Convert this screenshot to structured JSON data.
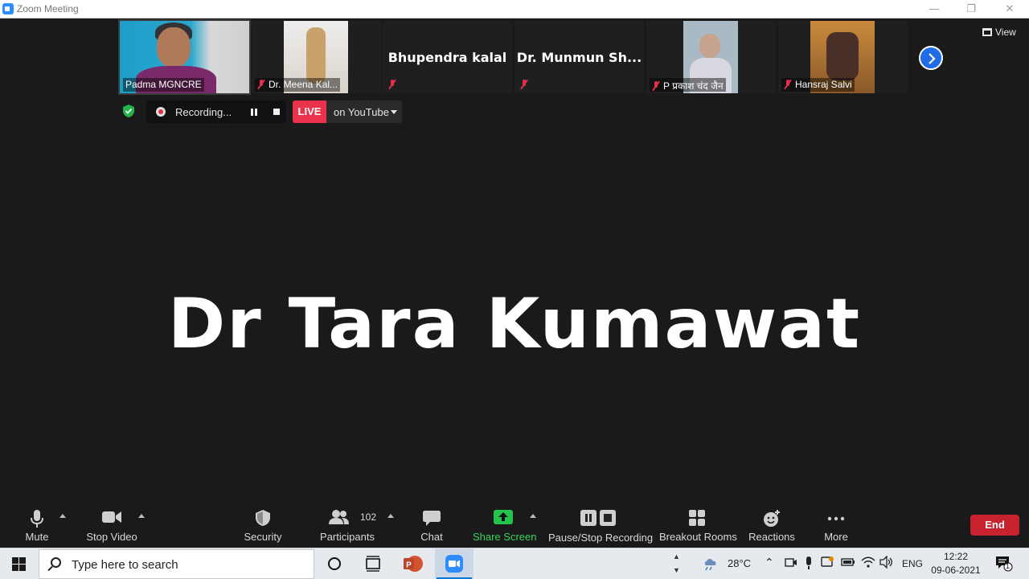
{
  "window": {
    "title": "Zoom Meeting"
  },
  "participants": [
    {
      "name": "Padma MGNCRE",
      "muted": false
    },
    {
      "name": "Dr. Meena Kal...",
      "muted": true
    },
    {
      "name": "Bhupendra kalal",
      "muted": true
    },
    {
      "name": "Dr. Munmun Sh...",
      "muted": true
    },
    {
      "name": "P प्रकाश चंद जैन",
      "muted": true
    },
    {
      "name": "Hansraj Salvi",
      "muted": true
    }
  ],
  "view_label": "View",
  "recording": {
    "status": "Recording..."
  },
  "live": {
    "badge": "LIVE",
    "platform": "on YouTube"
  },
  "active_speaker": "Dr Tara Kumawat",
  "toolbar": {
    "mute": "Mute",
    "stop_video": "Stop Video",
    "security": "Security",
    "participants": "Participants",
    "participants_count": "102",
    "chat": "Chat",
    "share_screen": "Share Screen",
    "pause_stop_recording": "Pause/Stop Recording",
    "breakout_rooms": "Breakout Rooms",
    "reactions": "Reactions",
    "more": "More",
    "end": "End"
  },
  "taskbar": {
    "search_placeholder": "Type here to search",
    "weather": "28°C",
    "language": "ENG",
    "time": "12:22",
    "date": "09-06-2021",
    "notification_count": "1"
  },
  "colors": {
    "accent": "#2d8cff",
    "live": "#e8334a",
    "end": "#c8222e",
    "share": "#38d45c"
  }
}
